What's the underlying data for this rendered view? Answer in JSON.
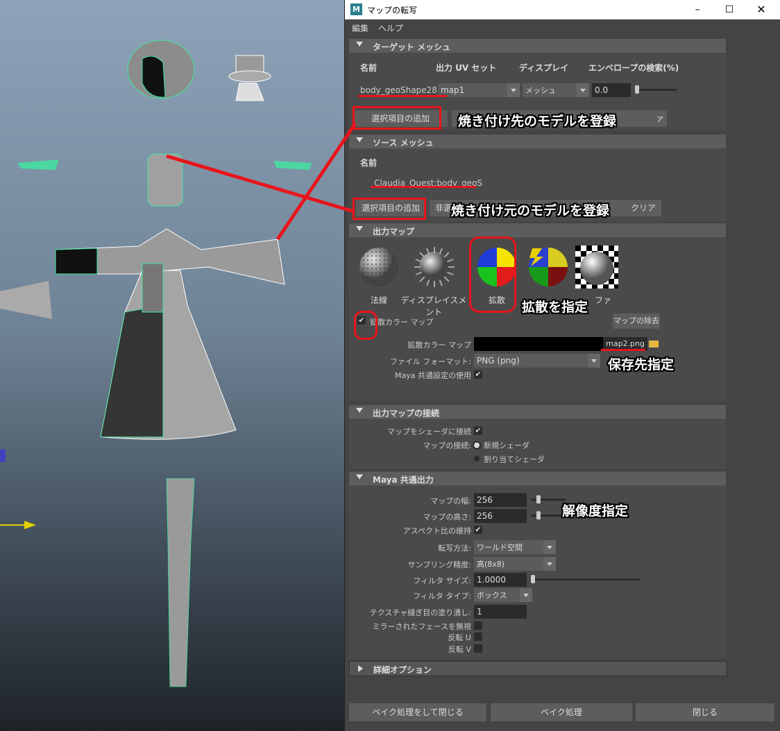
{
  "window": {
    "title": "マップの転写",
    "app_icon": "M"
  },
  "menu": [
    "編集",
    "ヘルプ"
  ],
  "target_mesh": {
    "section": "ターゲット メッシュ",
    "headers": [
      "名前",
      "出力 UV セット",
      "ディスプレイ",
      "エンベロープの検索(%)"
    ],
    "row": {
      "name": "body_geoShape28",
      "uv_set": "map1",
      "display": "メッシュ",
      "envelope": "0.0"
    },
    "add_button": "選択項目の追加",
    "remove_button": "ァ"
  },
  "source_mesh": {
    "section": "ソース メッシュ",
    "header": "名前",
    "name": "Claudia_Quest:body_geoS",
    "add_button": "選択項目の追加",
    "remove_button_left": "非選",
    "clear_button": "クリア"
  },
  "output_maps": {
    "section": "出力マップ",
    "maps": [
      {
        "icon": "normal-map-icon",
        "label": "法線"
      },
      {
        "icon": "displacement-map-icon",
        "label": "ディスプレイスメント"
      },
      {
        "icon": "diffuse-map-icon",
        "label": "拡散"
      },
      {
        "icon": "lighting-map-icon",
        "label": ""
      },
      {
        "icon": "ambient-occlusion-icon",
        "label": "ファ"
      }
    ],
    "diffuse_check_label": "拡散カラー マップ",
    "diffuse_checked": true,
    "remove_map_button": "マップの除去",
    "file_label": "拡散カラー マップ",
    "file_value": "map2.png",
    "format_label": "ファイル フォーマット:",
    "format_value": "PNG (png)",
    "maya_common_label": "Maya 共通設定の使用",
    "maya_common_checked": true
  },
  "connect": {
    "section": "出力マップの接続",
    "connect_label": "マップをシェーダに接続",
    "connect_checked": true,
    "connection_label": "マップの接続:",
    "options": [
      "新規シェーダ",
      "割り当てシェーダ"
    ]
  },
  "common_output": {
    "section": "Maya 共通出力",
    "width_label": "マップの幅:",
    "width": "256",
    "height_label": "マップの高さ:",
    "height": "256",
    "aspect_label": "アスペクト比の維持",
    "aspect_checked": true,
    "transfer_label": "転写方法:",
    "transfer_value": "ワールド空間",
    "sampling_label": "サンプリング精度:",
    "sampling_value": "高(8x8)",
    "filter_size_label": "フィルタ サイズ:",
    "filter_size": "1.0000",
    "filter_type_label": "フィルタ タイプ:",
    "filter_type_value": "ボックス",
    "seam_label": "テクスチャ縫ぎ目の塗り潰し:",
    "seam_value": "1",
    "mirror_label": "ミラーされたフェースを無視",
    "flip_u_label": "反転 U",
    "flip_v_label": "反転 V"
  },
  "advanced": {
    "section": "詳細オプション"
  },
  "footer": [
    "ベイク処理をして閉じる",
    "ベイク処理",
    "閉じる"
  ],
  "annotations": {
    "target": "焼き付け先のモデルを登録",
    "source": "焼き付け元のモデルを登録",
    "diffuse": "拡散を指定",
    "save": "保存先指定",
    "resolution": "解像度指定"
  },
  "colors": {
    "accent_red": "#e8151b",
    "wire_green": "#3ee8a0"
  }
}
